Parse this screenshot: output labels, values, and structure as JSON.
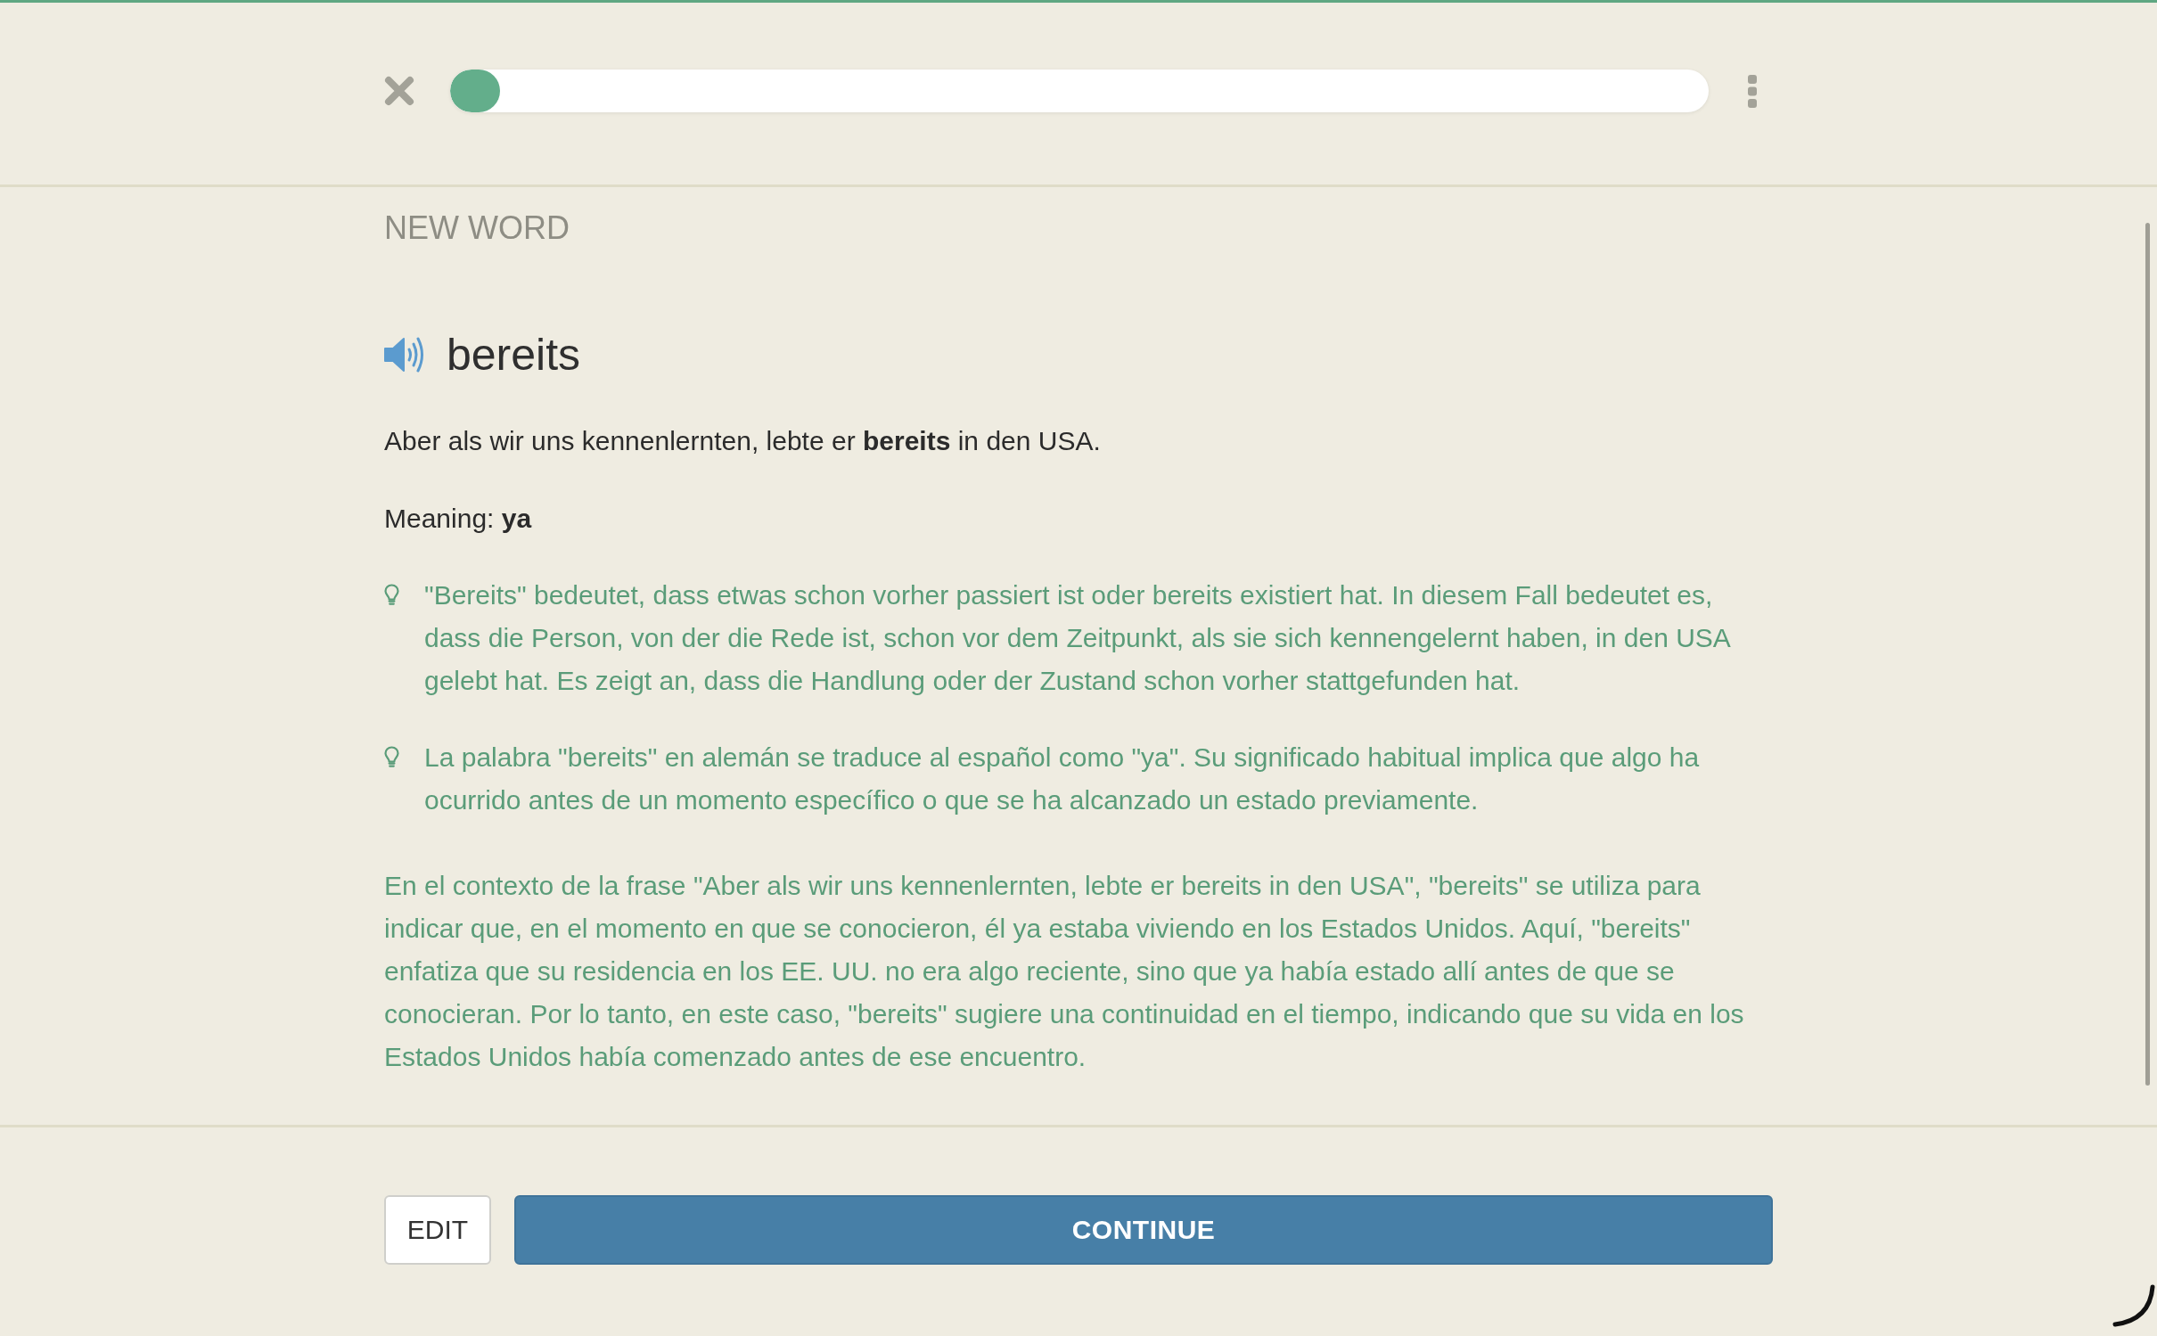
{
  "header": {
    "progress": {
      "level": 0.04
    }
  },
  "card": {
    "label": "NEW WORD",
    "word": "bereits",
    "example": "Aber als wir uns kennenlernten, lebte er **bereits** in den USA.",
    "meaning": "Meaning: **ya**"
  },
  "explanations": [
    {
      "kind": "hint",
      "text": "\"Bereits\" bedeutet, dass etwas schon vorher passiert ist oder bereits existiert hat. In diesem Fall bedeutet es, dass die Person, von der die Rede ist, schon vor dem Zeitpunkt, als sie sich kennengelernt haben, in den USA gelebt hat. Es zeigt an, dass die Handlung oder der Zustand schon vorher stattgefunden hat."
    },
    {
      "kind": "hint",
      "text": "La palabra \"bereits\" en alemán se traduce al español como \"ya\". Su significado habitual implica que algo ha ocurrido antes de un momento específico o que se ha alcanzado un estado previamente."
    },
    {
      "kind": "paragraph",
      "text": "En el contexto de la frase \"Aber als wir uns kennenlernten, lebte er bereits in den USA\", \"bereits\" se utiliza para indicar que, en el momento en que se conocieron, él ya estaba viviendo en los Estados Unidos. Aquí, \"bereits\" enfatiza que su residencia en los EE. UU. no era algo reciente, sino que ya había estado allí antes de que se conocieran. Por lo tanto, en este caso, \"bereits\" sugiere una continuidad en el tiempo, indicando que su vida en los Estados Unidos había comenzado antes de ese encuentro."
    }
  ],
  "buttons": [
    {
      "kind": "secondary",
      "label": "EDIT"
    },
    {
      "kind": "primary",
      "label": "CONTINUE"
    }
  ]
}
